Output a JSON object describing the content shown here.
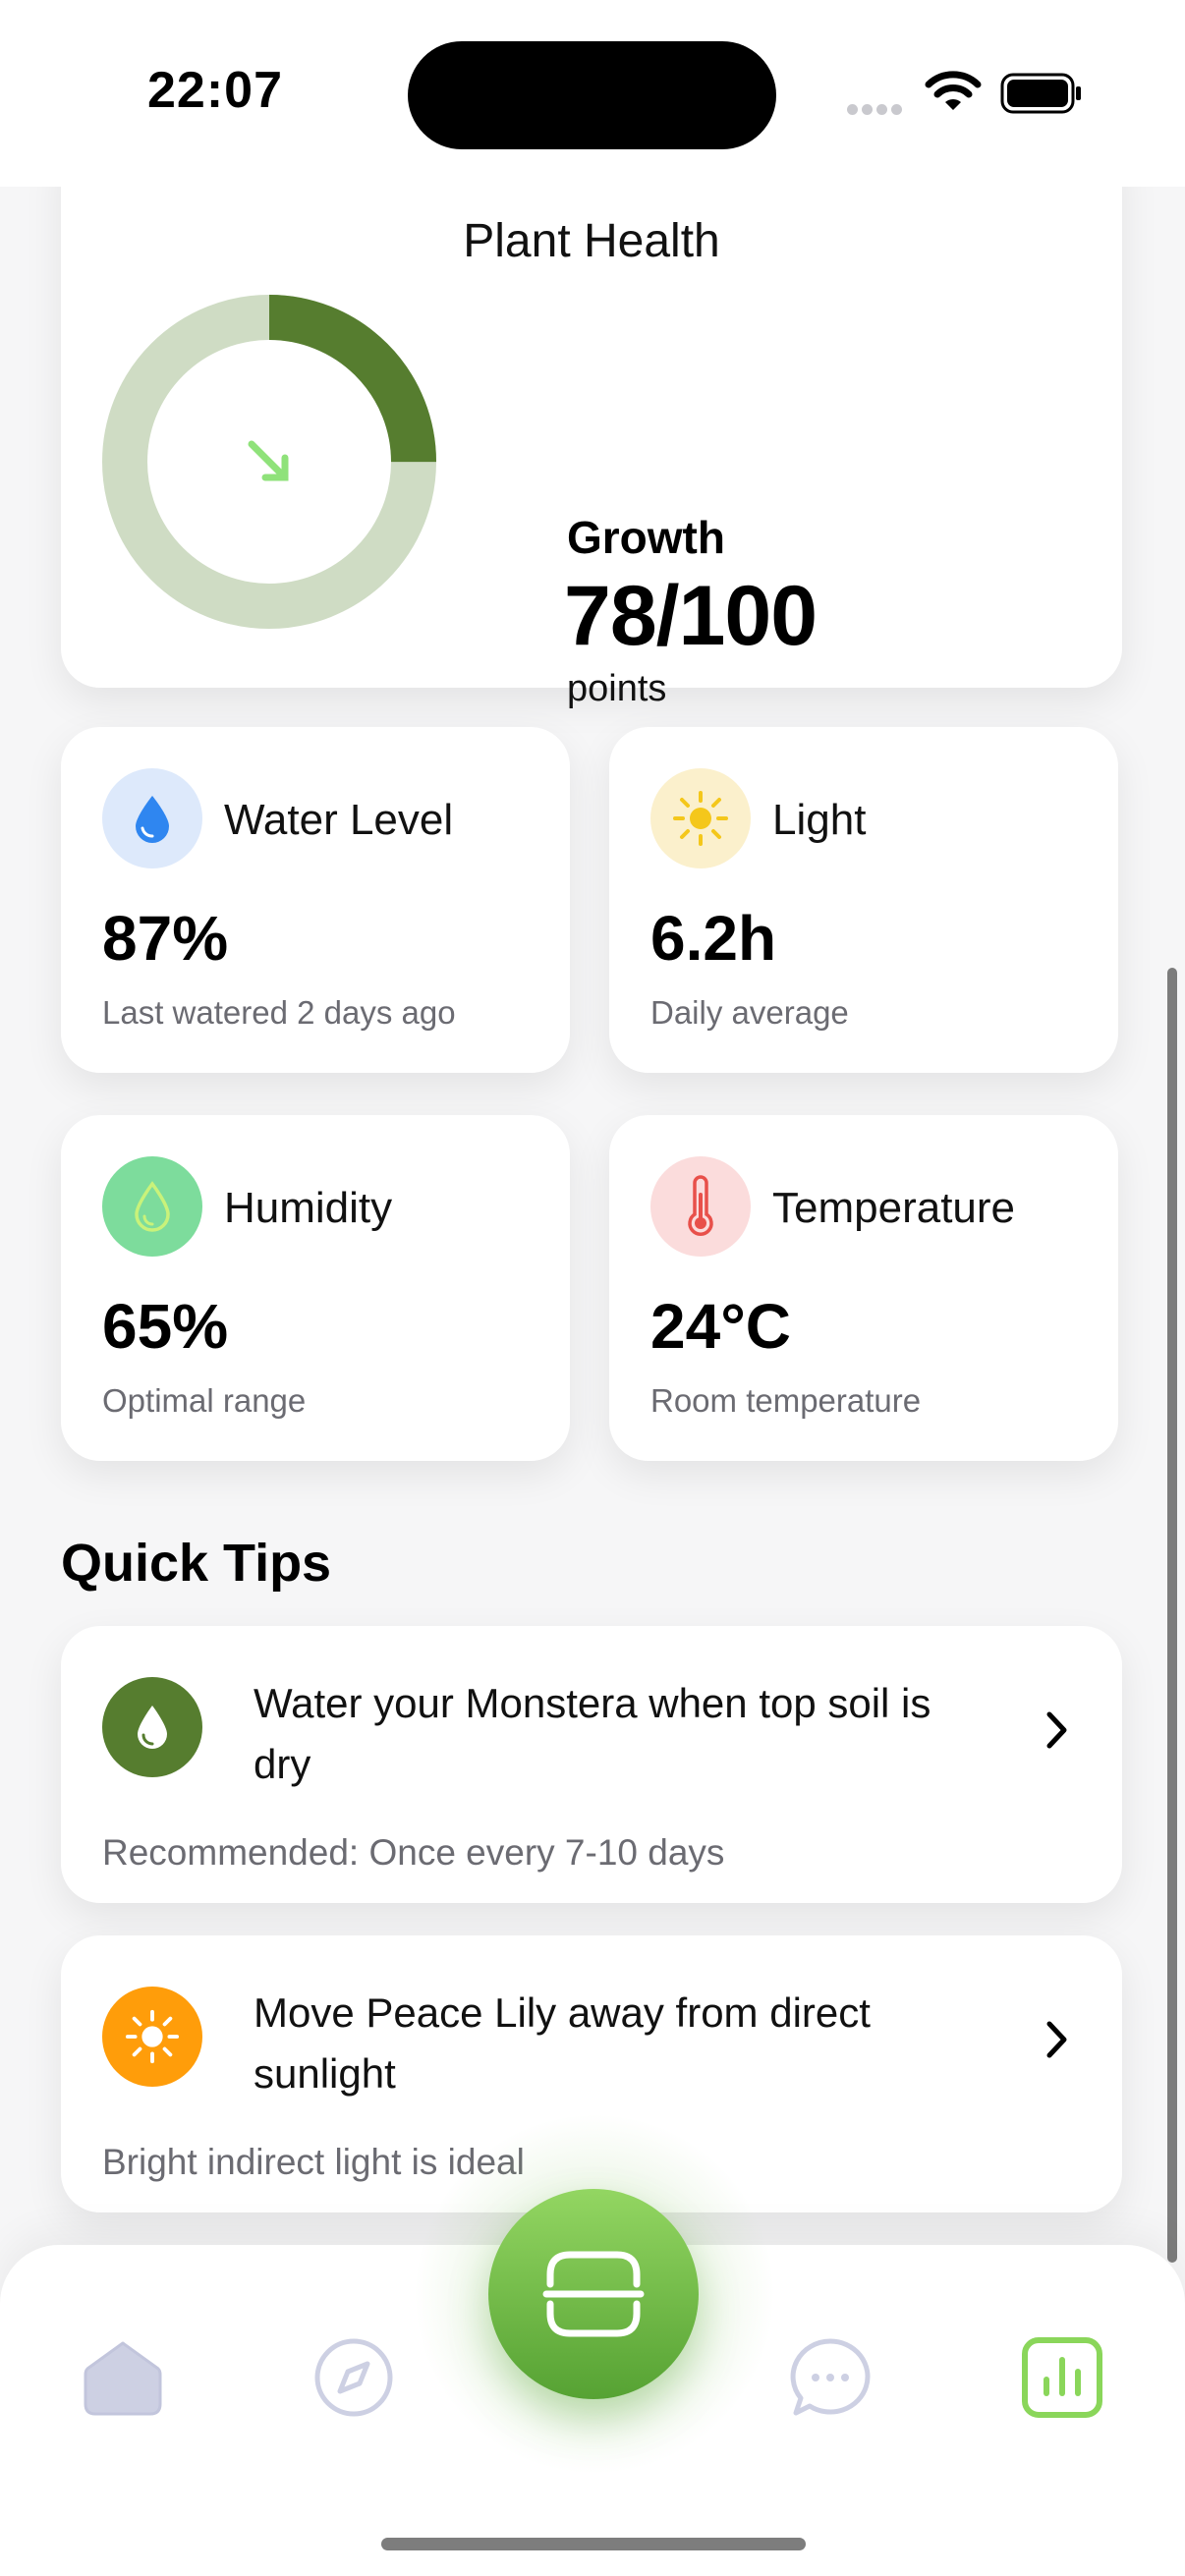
{
  "status_bar": {
    "time": "22:07"
  },
  "plant_health": {
    "title": "Plant Health",
    "metric_label": "Growth",
    "score_text": "78/100",
    "unit": "points",
    "score_fraction": 0.25,
    "ring_color": "#567d2f",
    "ring_track_color": "#cfdcc4",
    "arrow_color": "#8fe27a"
  },
  "stats": [
    {
      "title": "Water Level",
      "value": "87%",
      "subtitle": "Last watered 2 days ago",
      "icon": "water-drop-icon",
      "icon_bg": "#dde9fb",
      "icon_color": "#2f86f0"
    },
    {
      "title": "Light",
      "value": "6.2h",
      "subtitle": "Daily average",
      "icon": "sun-icon",
      "icon_bg": "#fbf0cc",
      "icon_color": "#f4c71b"
    },
    {
      "title": "Humidity",
      "value": "65%",
      "subtitle": "Optimal range",
      "icon": "humidity-drop-icon",
      "icon_bg": "#7ddc9c",
      "icon_color": "#c9f27a"
    },
    {
      "title": "Temperature",
      "value": "24°C",
      "subtitle": "Room temperature",
      "icon": "thermometer-icon",
      "icon_bg": "#fbdcdc",
      "icon_color": "#e8504a"
    }
  ],
  "quick_tips": {
    "title": "Quick Tips",
    "items": [
      {
        "title": "Water your Monstera when top soil is dry",
        "subtitle": "Recommended: Once every 7-10 days",
        "icon": "water-drop-icon",
        "icon_bg": "#567d2f"
      },
      {
        "title": "Move Peace Lily away from direct sunlight",
        "subtitle": "Bright indirect light is ideal",
        "icon": "sun-icon",
        "icon_bg": "#ff9d0a"
      }
    ]
  },
  "tab_bar": {
    "tabs": [
      "home-icon",
      "compass-icon",
      "scan-icon",
      "chat-icon",
      "stats-icon"
    ],
    "active": "stats-icon",
    "active_color": "#8ad65a",
    "inactive_color": "#cdd0e3"
  }
}
